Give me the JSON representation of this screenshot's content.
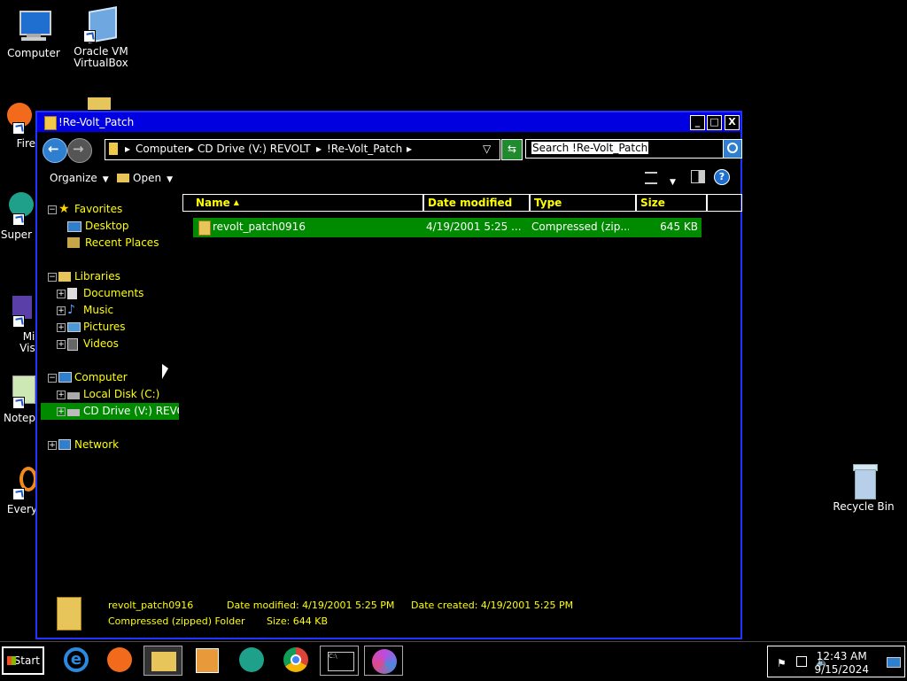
{
  "desktop": {
    "icons": [
      {
        "label": "Computer"
      },
      {
        "label": "Oracle VM VirtualBox"
      },
      {
        "label": "Fire"
      },
      {
        "label": "Super"
      },
      {
        "label": "Micro Visual"
      },
      {
        "label": "Notep"
      },
      {
        "label": "Every"
      },
      {
        "label": "Recycle Bin"
      }
    ]
  },
  "window": {
    "title": "!Re-Volt_Patch",
    "buttons": {
      "minimize": "_",
      "maximize": "□",
      "close": "X"
    },
    "address": [
      "Computer",
      "CD Drive (V:) REVOLT",
      "!Re-Volt_Patch"
    ],
    "search_placeholder": "Search !Re-Volt_Patch",
    "toolbar": {
      "organize": "Organize",
      "open": "Open"
    }
  },
  "navpane": {
    "favorites": {
      "label": "Favorites",
      "items": [
        "Desktop",
        "Recent Places"
      ]
    },
    "libraries": {
      "label": "Libraries",
      "items": [
        "Documents",
        "Music",
        "Pictures",
        "Videos"
      ]
    },
    "computer": {
      "label": "Computer",
      "items": [
        "Local Disk (C:)",
        "CD Drive (V:) REVOLT"
      ]
    },
    "network": {
      "label": "Network"
    }
  },
  "filelist": {
    "columns": [
      "Name",
      "Date modified",
      "Type",
      "Size"
    ],
    "rows": [
      {
        "name": "revolt_patch0916",
        "date": "4/19/2001 5:25 ...",
        "type": "Compressed (zip...",
        "size": "645 KB"
      }
    ]
  },
  "details": {
    "name": "revolt_patch0916",
    "type": "Compressed (zipped) Folder",
    "date_modified": "Date modified: 4/19/2001 5:25 PM",
    "date_created": "Date created: 4/19/2001 5:25 PM",
    "size": "Size: 644 KB"
  },
  "taskbar": {
    "start": "Start",
    "time": "12:43 AM",
    "date": "9/15/2024"
  }
}
